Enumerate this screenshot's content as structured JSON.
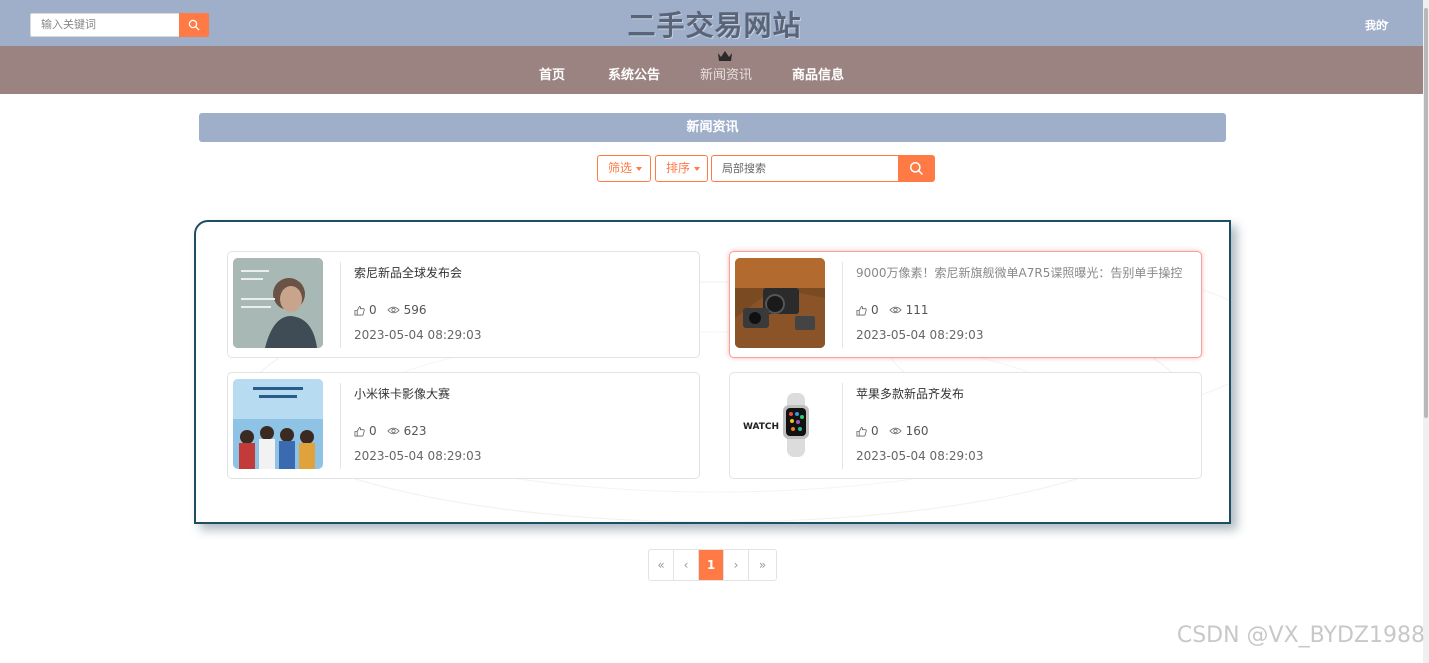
{
  "header": {
    "search_placeholder": "输入关键词",
    "site_title": "二手交易网站",
    "user_menu": "我的"
  },
  "nav": {
    "items": [
      {
        "label": "首页"
      },
      {
        "label": "系统公告"
      },
      {
        "label": "新闻资讯",
        "active": true
      },
      {
        "label": "商品信息"
      }
    ]
  },
  "section": {
    "title": "新闻资讯",
    "filter_label": "筛选",
    "sort_label": "排序",
    "search_placeholder": "局部搜索"
  },
  "news": [
    {
      "title": "索尼新品全球发布会",
      "likes": "0",
      "views": "596",
      "date": "2023-05-04 08:29:03"
    },
    {
      "title": "9000万像素！索尼新旗舰微单A7R5谍照曝光：告别单手操控",
      "likes": "0",
      "views": "111",
      "date": "2023-05-04 08:29:03"
    },
    {
      "title": "小米徕卡影像大赛",
      "likes": "0",
      "views": "623",
      "date": "2023-05-04 08:29:03"
    },
    {
      "title": "苹果多款新品齐发布",
      "likes": "0",
      "views": "160",
      "date": "2023-05-04 08:29:03"
    }
  ],
  "pagination": {
    "first": "«",
    "prev": "‹",
    "current": "1",
    "next": "›",
    "last": "»"
  },
  "thumb_text": {
    "watch_brand": "WATCH"
  },
  "watermark": "CSDN @VX_BYDZ1988",
  "colors": {
    "topbar": "#9fafc9",
    "navbar": "#9a8380",
    "accent": "#ff7a45",
    "panel_border": "#1f4e63"
  }
}
